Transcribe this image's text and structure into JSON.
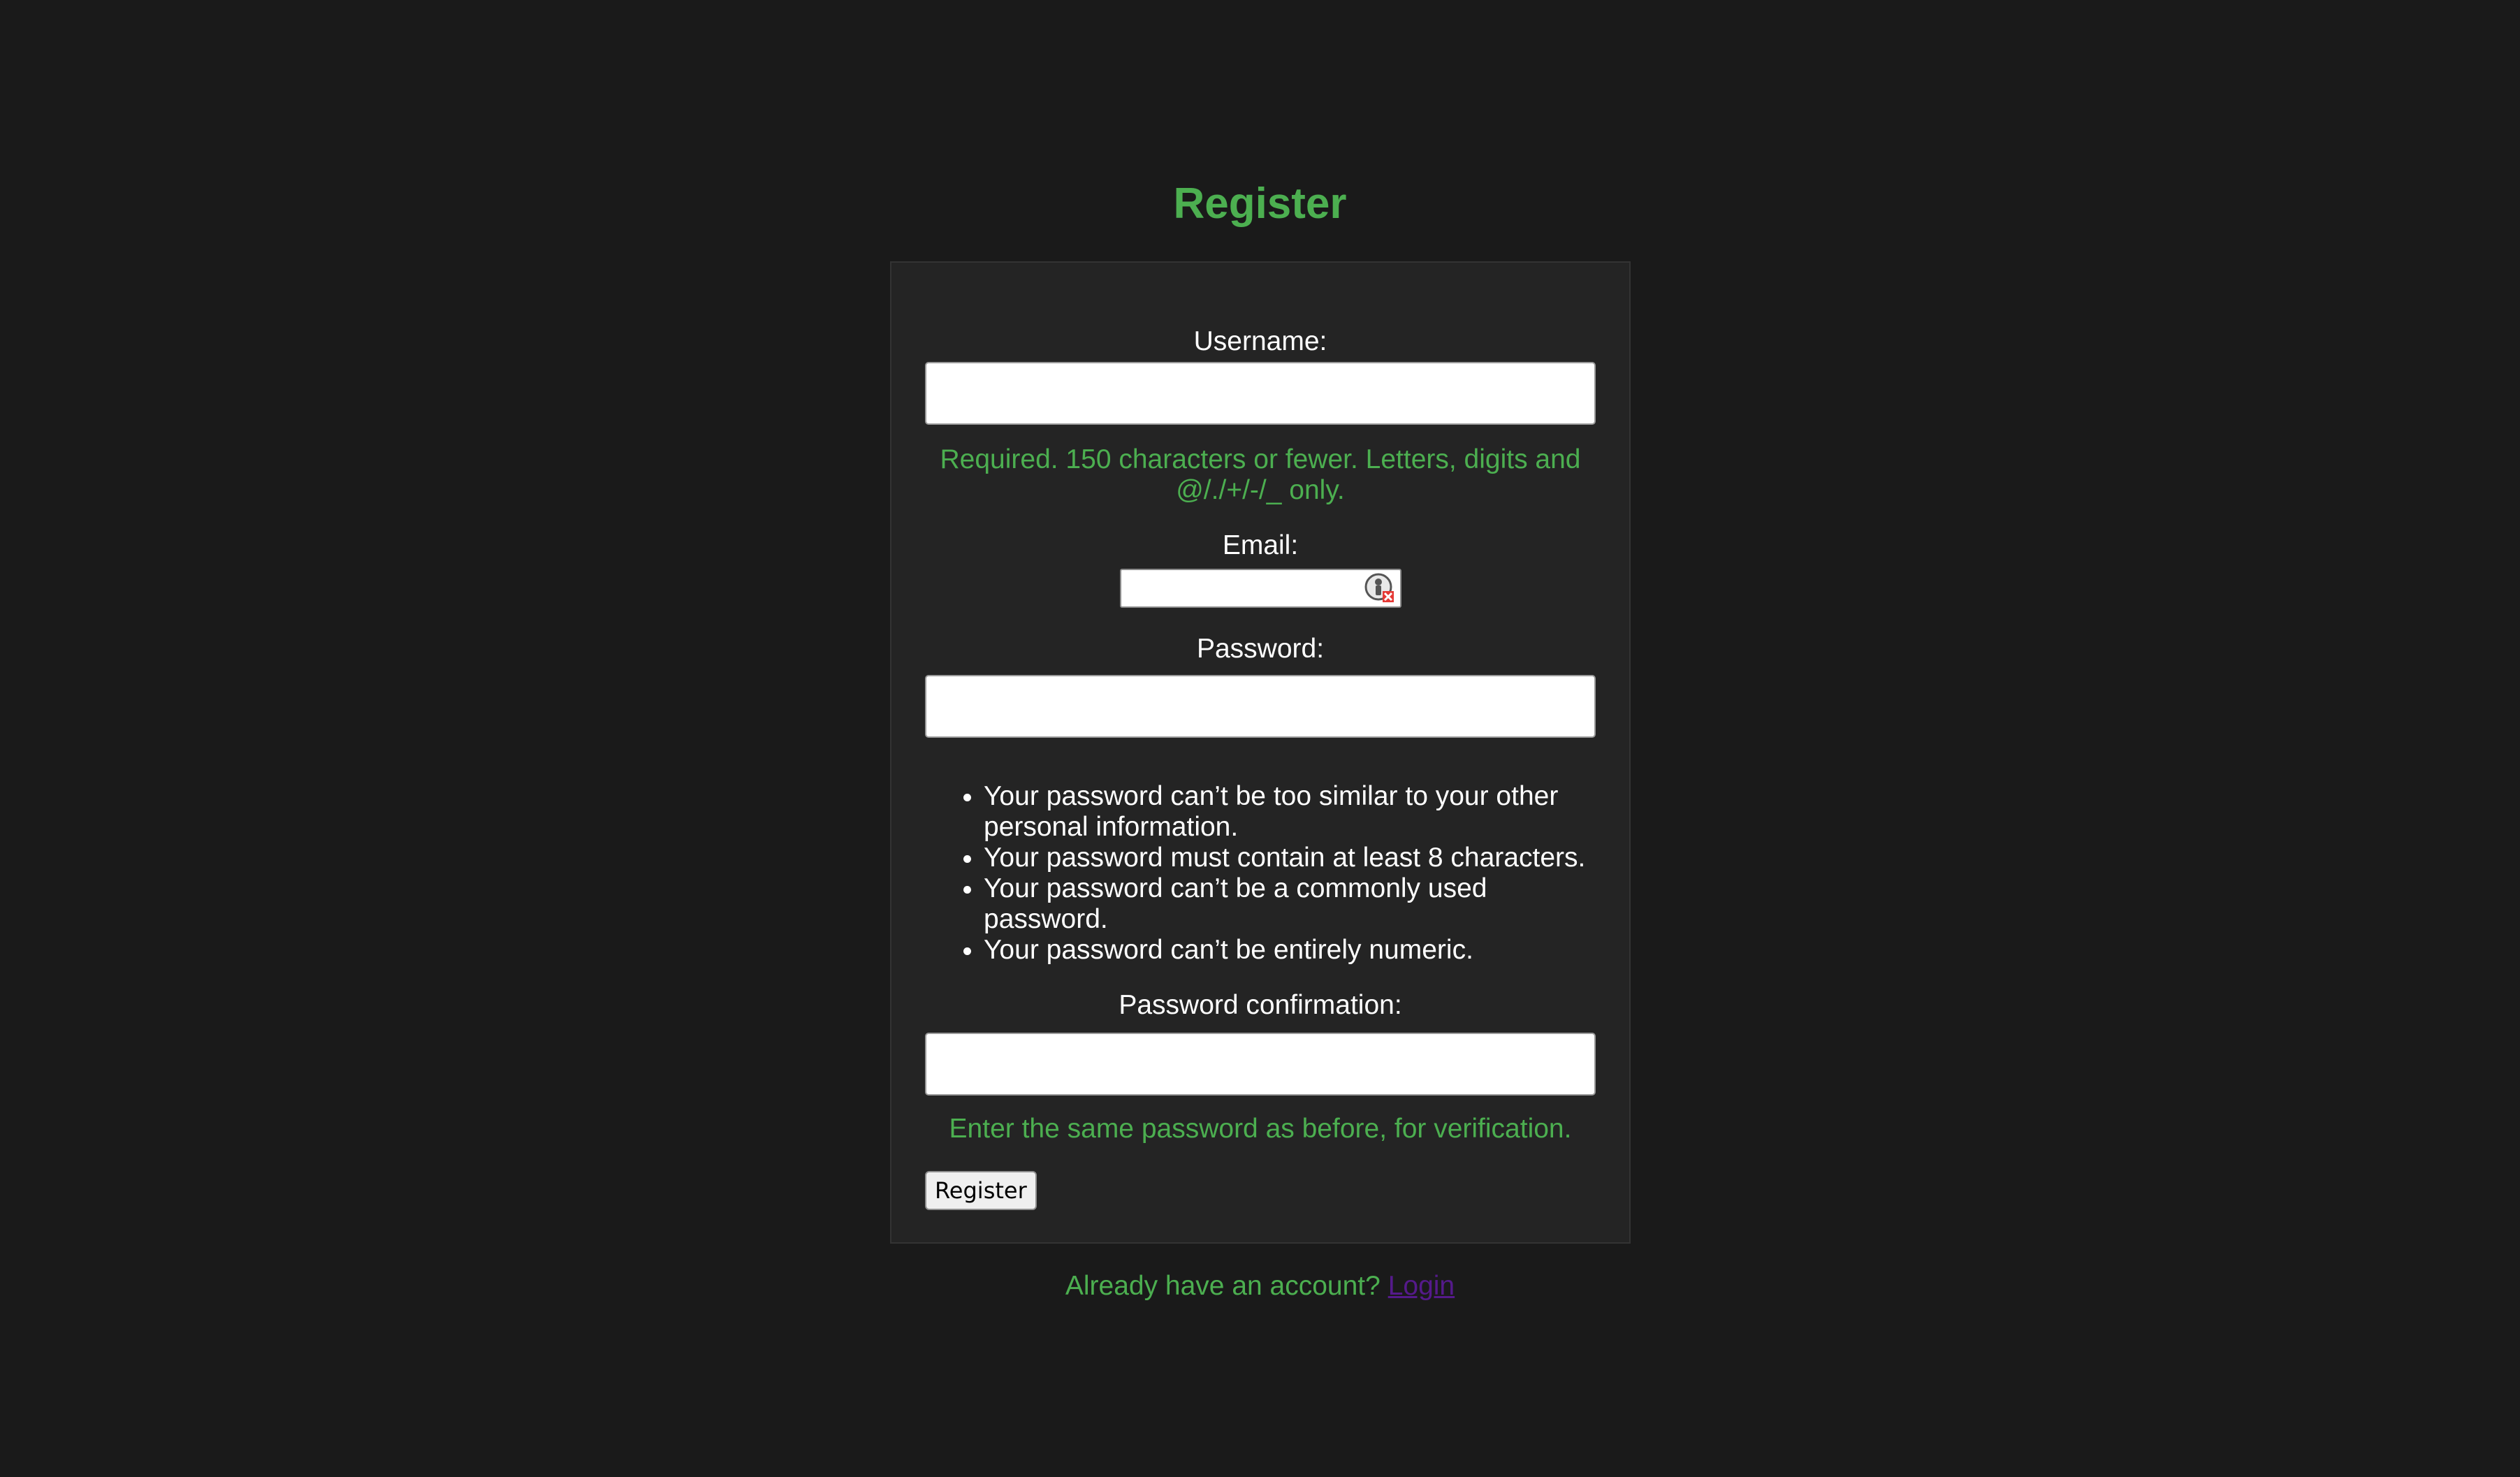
{
  "page": {
    "title": "Register"
  },
  "form": {
    "username": {
      "label": "Username:",
      "value": "",
      "help": "Required. 150 characters or fewer. Letters, digits and @/./+/-/_ only."
    },
    "email": {
      "label": "Email:",
      "value": "",
      "icon": "password-manager-icon"
    },
    "password": {
      "label": "Password:",
      "value": "",
      "rules": [
        "Your password can’t be too similar to your other personal information.",
        "Your password must contain at least 8 characters.",
        "Your password can’t be a commonly used password.",
        "Your password can’t be entirely numeric."
      ]
    },
    "password_confirmation": {
      "label": "Password confirmation:",
      "value": "",
      "help": "Enter the same password as before, for verification."
    },
    "submit_label": "Register"
  },
  "footer": {
    "prompt": "Already have an account?",
    "login_link": "Login"
  },
  "colors": {
    "background": "#1a1a1a",
    "card": "#242424",
    "accent": "#4caf50",
    "link": "#551a8b"
  }
}
